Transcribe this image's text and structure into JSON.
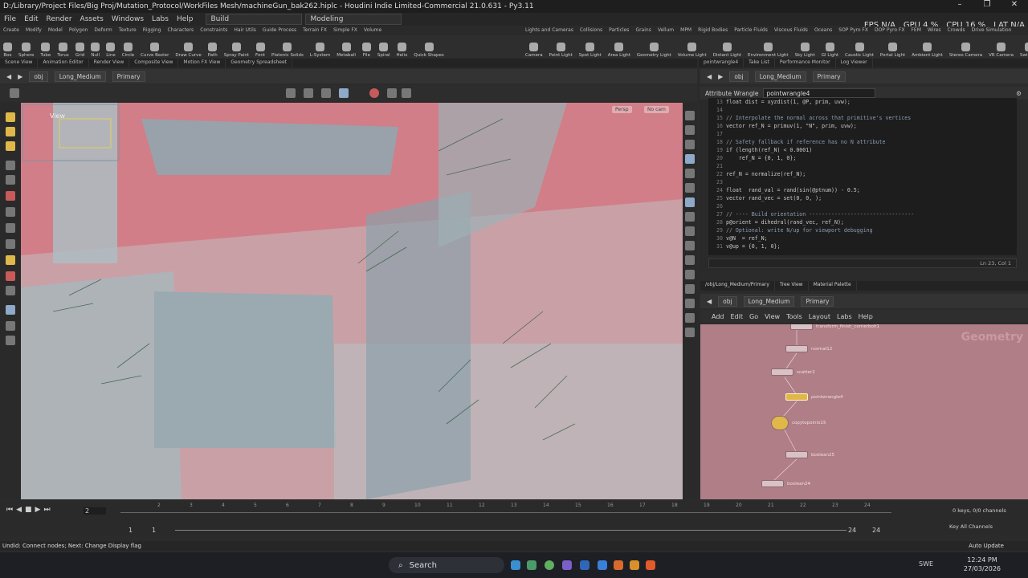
{
  "window": {
    "title": "D:/Library/Project Files/Big Proj/Mutation_Protocol/WorkFiles Mesh/machineGun_bak262.hiplc - Houdini Indie Limited-Commercial 21.0.631 - Py3.11"
  },
  "menubar": {
    "items": [
      "File",
      "Edit",
      "Render",
      "Assets",
      "Windows",
      "Labs",
      "Help"
    ],
    "desktop_build": "Build",
    "desktop_modeling": "Modeling"
  },
  "perf": {
    "fps": "FPS N/A",
    "gpu": "GPU 4 %",
    "cpu": "CPU 16 %",
    "lat": "LAT N/A"
  },
  "shelf_tabs_left": [
    "Create",
    "Modify",
    "Model",
    "Polygon",
    "Deform",
    "Texture",
    "Rigging",
    "Characters",
    "Constraints",
    "Hair Utils",
    "Guide Process",
    "Terrain FX",
    "Simple FX",
    "Volume"
  ],
  "shelf_tabs_right": [
    "Lights and Cameras",
    "Collisions",
    "Particles",
    "Grains",
    "Vellum",
    "MPM",
    "Rigid Bodies",
    "Particle Fluids",
    "Viscous Fluids",
    "Oceans",
    "SOP Pyro FX",
    "DOP Pyro FX",
    "FEM",
    "Wires",
    "Crowds",
    "Drive Simulation"
  ],
  "tools_left": [
    "Box",
    "Sphere",
    "Tube",
    "Torus",
    "Grid",
    "Null",
    "Line",
    "Circle",
    "Curve Bezier",
    "Draw Curve",
    "Path",
    "Spray Paint",
    "Font",
    "Platonic Solids",
    "L-System",
    "Metaball",
    "File",
    "Spiral",
    "Helix",
    "Quick Shapes"
  ],
  "tools_right": [
    "Camera",
    "Point Light",
    "Spot Light",
    "Area Light",
    "Geometry Light",
    "Volume Light",
    "Distant Light",
    "Environment Light",
    "Sky Light",
    "GI Light",
    "Caustic Light",
    "Portal Light",
    "Ambient Light",
    "Stereo Camera",
    "VR Camera",
    "Switcher",
    "Gas Camera"
  ],
  "pane_tabs_left": [
    "Scene View",
    "Animation Editor",
    "Render View",
    "Composite View",
    "Motion FX View",
    "Geometry Spreadsheet"
  ],
  "pane_tabs_right": [
    "pointwrangle4",
    "Take List",
    "Performance Monitor",
    "Log Viewer"
  ],
  "path_left": {
    "obj": "obj",
    "node": "Long_Medium",
    "net": "Primary"
  },
  "path_right": {
    "obj": "obj",
    "node": "Long_Medium",
    "net": "Primary"
  },
  "viewport": {
    "view_label": "View",
    "persp": "Persp",
    "cam": "No cam"
  },
  "code": {
    "node_type": "Attribute Wrangle",
    "node_name": "pointwrangle4",
    "lines": [
      {
        "n": "13",
        "t": "float dist = xyzdist(1, @P, prim, uvw);"
      },
      {
        "n": "14",
        "t": ""
      },
      {
        "n": "15",
        "t": "// Interpolate the normal across that primitive's vertices"
      },
      {
        "n": "16",
        "t": "vector ref_N = primuv(1, \"N\", prim, uvw);"
      },
      {
        "n": "17",
        "t": ""
      },
      {
        "n": "18",
        "t": "// Safety fallback if reference has no N attribute"
      },
      {
        "n": "19",
        "t": "if (length(ref_N) < 0.0001)"
      },
      {
        "n": "20",
        "t": "    ref_N = {0, 1, 0};"
      },
      {
        "n": "21",
        "t": ""
      },
      {
        "n": "22",
        "t": "ref_N = normalize(ref_N);"
      },
      {
        "n": "23",
        "t": ""
      },
      {
        "n": "24",
        "t": "float  rand_val = rand(sin(@ptnum)) - 0.5;"
      },
      {
        "n": "25",
        "t": "vector rand_vec = set(0, 0, );"
      },
      {
        "n": "26",
        "t": ""
      },
      {
        "n": "27",
        "t": "// ---- Build orientation ---------------------------------"
      },
      {
        "n": "28",
        "t": "p@orient = dihedral(rand_vec, ref_N);"
      },
      {
        "n": "29",
        "t": "// Optional: write N/up for viewport debugging"
      },
      {
        "n": "30",
        "t": "v@N  = ref_N;"
      },
      {
        "n": "31",
        "t": "v@up = {0, 1, 0};"
      }
    ],
    "status": "Ln 23, Col 1"
  },
  "network": {
    "tabs": [
      "/obj/Long_Medium/Primary",
      "Tree View",
      "Material Palette"
    ],
    "menu": [
      "Add",
      "Edit",
      "Go",
      "View",
      "Tools",
      "Layout",
      "Labs",
      "Help"
    ],
    "context_label": "Geometry",
    "nodes": [
      "transform_finish_cornerbolt1",
      "normal12",
      "scatter2",
      "pointwrangle4",
      "copytopoints15",
      "boolean25",
      "boolean24"
    ]
  },
  "timeline": {
    "frame": "2",
    "ticks": [
      "2",
      "3",
      "4",
      "5",
      "6",
      "7",
      "8",
      "9",
      "10",
      "11",
      "12",
      "13",
      "14",
      "15",
      "16",
      "17",
      "18",
      "19",
      "20",
      "21",
      "22",
      "23",
      "24"
    ],
    "start": "1",
    "start2": "1",
    "end": "24",
    "end2": "24",
    "keys": "0 keys, 0/0 channels",
    "keyall": "Key All Channels",
    "autoupdate": "Auto Update"
  },
  "statusline": "Undid: Connect nodes; Next: Change Display flag",
  "taskbar": {
    "search": "Search",
    "lang": "SWE",
    "time": "12:24 PM",
    "date": "27/03/2026"
  },
  "colors": {
    "viewport_bg": "#c9a0a6",
    "network_bg": "#b07e86",
    "accent": "#e0b84a"
  }
}
